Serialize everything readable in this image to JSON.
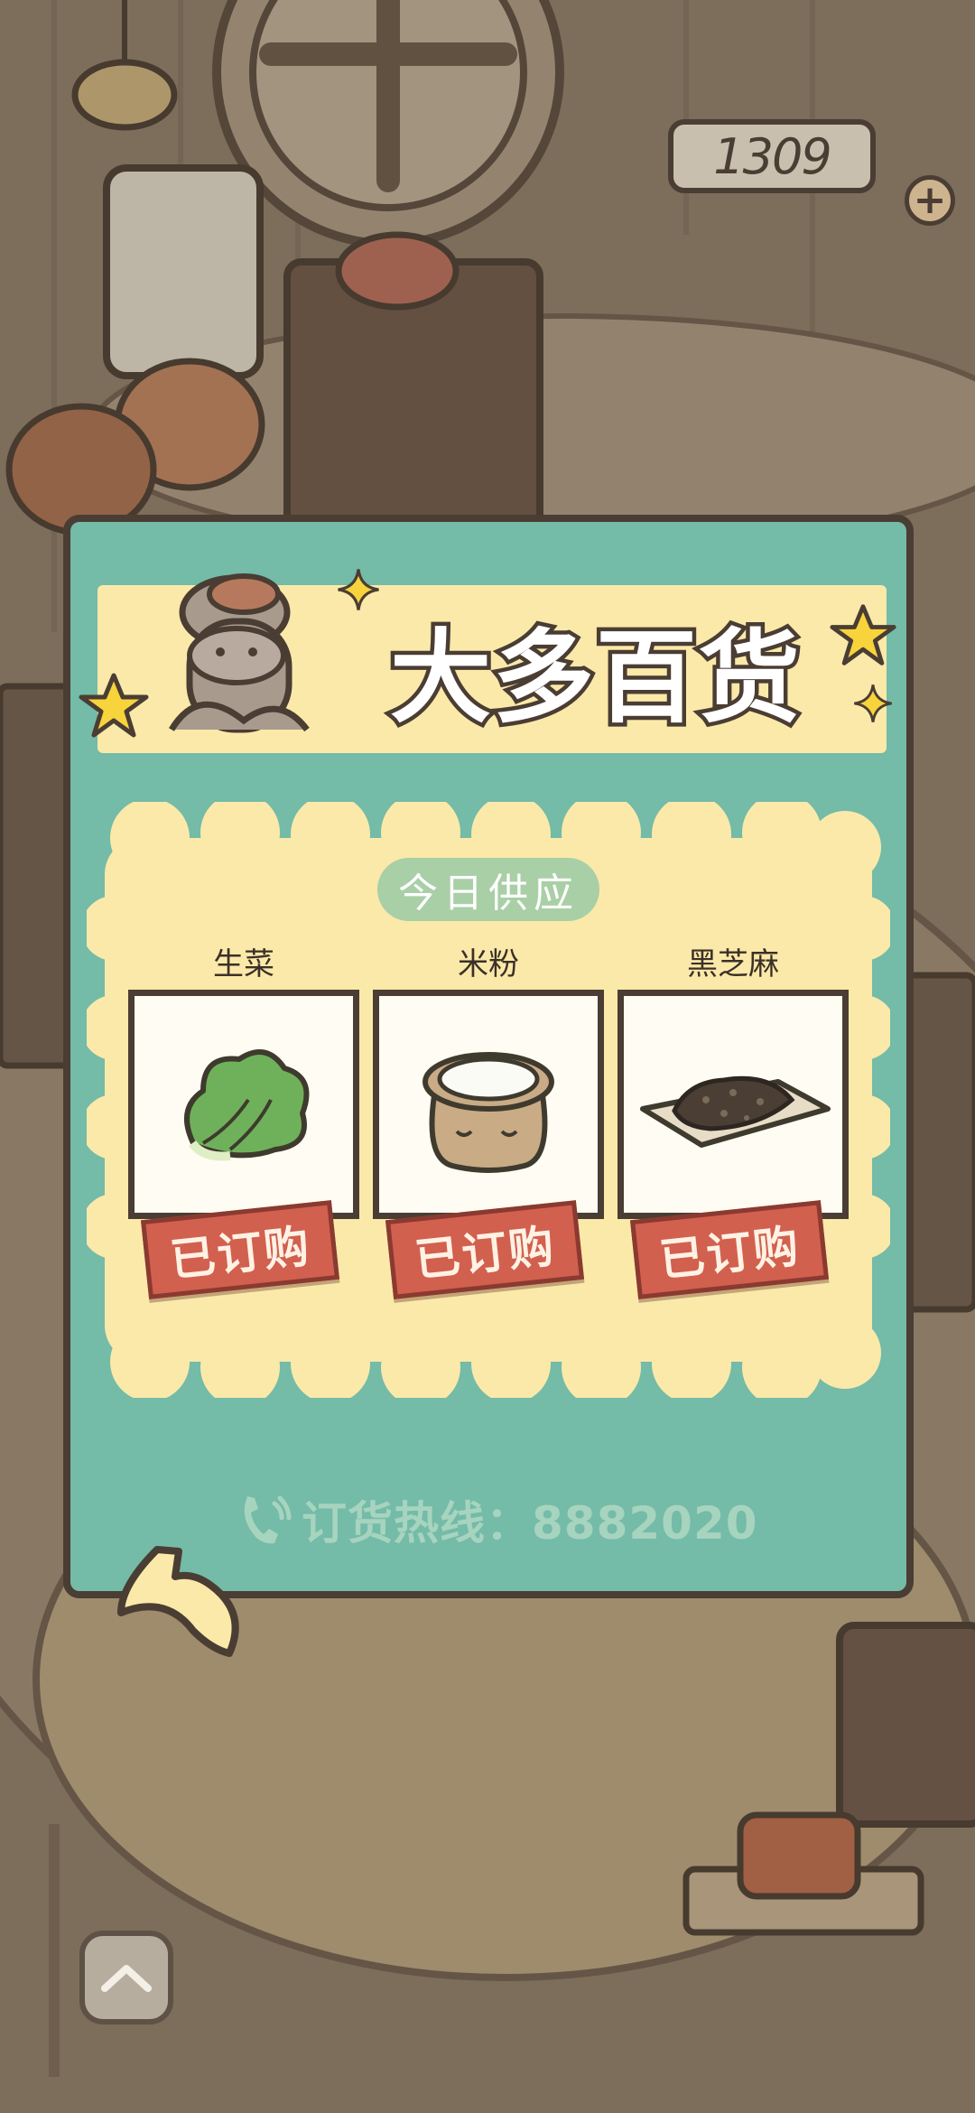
{
  "coins": {
    "value": "1309",
    "add_label": "+"
  },
  "shop": {
    "title": "大多百货",
    "supply_title": "今日供应",
    "hotline": "订货热线：8882020",
    "items": [
      {
        "name": "生菜",
        "status": "已订购",
        "icon": "lettuce-icon"
      },
      {
        "name": "米粉",
        "status": "已订购",
        "icon": "flour-sack-icon"
      },
      {
        "name": "黑芝麻",
        "status": "已订购",
        "icon": "black-sesame-icon"
      }
    ]
  },
  "controls": {
    "back": "back-arrow-icon",
    "up": "chevron-up-icon"
  },
  "colors": {
    "panel": "#74bba8",
    "banner": "#fbe9a9",
    "stamp": "#d2604f",
    "outline": "#4a3d33"
  }
}
